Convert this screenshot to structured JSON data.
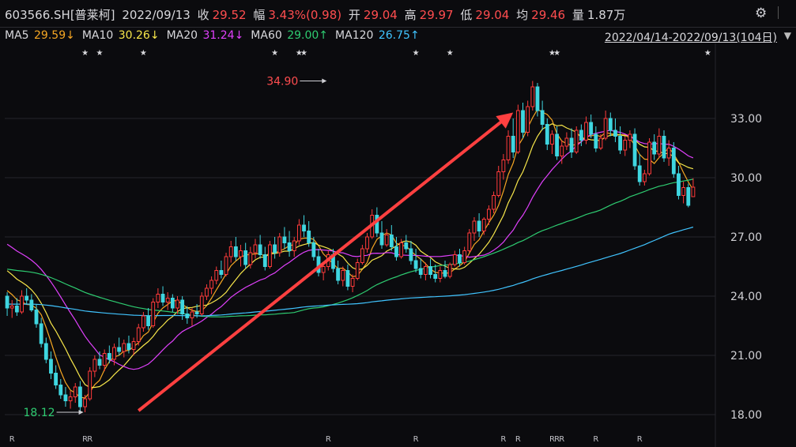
{
  "header": {
    "code": "603566.SH[普莱柯]",
    "date": "2022/09/13",
    "close_label": "收",
    "close": "29.52",
    "change_label": "幅",
    "change": "3.43%(0.98)",
    "open_label": "开",
    "open": "29.04",
    "high_label": "高",
    "high": "29.97",
    "low_label": "低",
    "low": "29.04",
    "avg_label": "均",
    "avg": "29.46",
    "vol_label": "量",
    "vol": "1.87万",
    "settings_icon": "gear-icon"
  },
  "ma_legend": [
    {
      "label": "MA5",
      "value": "29.59↓",
      "color": "#f5a623"
    },
    {
      "label": "MA10",
      "value": "30.26↓",
      "color": "#f7e64a"
    },
    {
      "label": "MA20",
      "value": "31.24↓",
      "color": "#e040fb"
    },
    {
      "label": "MA60",
      "value": "29.00↑",
      "color": "#2ecc71"
    },
    {
      "label": "MA120",
      "value": "26.75↑",
      "color": "#40c4ff"
    }
  ],
  "range_label": "2022/04/14-2022/09/13(104日)",
  "chart_data": {
    "type": "candlestick",
    "ylim": [
      17.2,
      36.2
    ],
    "yticks": [
      "33.00",
      "30.00",
      "27.00",
      "24.00",
      "21.00",
      "18.00"
    ],
    "ytick_values": [
      33,
      30,
      27,
      24,
      21,
      18
    ],
    "colors": {
      "up": "#ff3b3b",
      "down": "#3fd6e0",
      "arrow": "#ff4040"
    },
    "annotations": [
      {
        "text": "34.90",
        "value": 34.9,
        "index": 66,
        "color": "#ff4d4f"
      },
      {
        "text": "18.12",
        "value": 18.12,
        "index": 16,
        "color": "#2ecc71"
      }
    ],
    "star_indices": [
      16,
      19,
      28,
      55,
      60,
      61,
      84,
      91,
      112,
      113,
      144
    ],
    "star_marks": [
      "★",
      "★",
      "★",
      "★",
      "★",
      "★",
      "★",
      "★",
      "★",
      "★",
      "★"
    ],
    "r_indices": [
      1,
      16,
      17,
      66,
      84,
      102,
      105,
      112,
      113,
      114,
      121,
      130
    ],
    "r_marks": [
      "R",
      "R",
      "R",
      "R",
      "R",
      "R",
      "R",
      "R",
      "R",
      "R",
      "R",
      "R"
    ],
    "trend_arrow": {
      "from": [
        27,
        18.2
      ],
      "to": [
        104,
        33.3
      ]
    },
    "candles": [
      [
        24.0,
        24.2,
        23.0,
        23.4
      ],
      [
        23.4,
        23.8,
        22.9,
        23.5
      ],
      [
        23.5,
        23.9,
        23.0,
        23.2
      ],
      [
        23.2,
        24.3,
        23.1,
        24.0
      ],
      [
        24.0,
        24.4,
        23.6,
        23.8
      ],
      [
        23.8,
        24.1,
        23.2,
        23.3
      ],
      [
        23.3,
        23.6,
        22.4,
        22.6
      ],
      [
        22.6,
        22.9,
        21.4,
        21.6
      ],
      [
        21.6,
        21.9,
        20.6,
        20.8
      ],
      [
        20.8,
        21.2,
        19.8,
        20.1
      ],
      [
        20.1,
        20.5,
        19.3,
        19.5
      ],
      [
        19.5,
        19.8,
        18.8,
        19.0
      ],
      [
        19.0,
        19.4,
        18.4,
        18.7
      ],
      [
        18.7,
        19.2,
        18.3,
        18.9
      ],
      [
        18.9,
        19.6,
        18.6,
        19.4
      ],
      [
        19.4,
        19.7,
        18.2,
        18.4
      ],
      [
        18.4,
        19.0,
        18.12,
        18.8
      ],
      [
        18.8,
        20.4,
        18.7,
        20.2
      ],
      [
        20.2,
        21.0,
        19.9,
        20.8
      ],
      [
        20.8,
        21.2,
        20.3,
        20.5
      ],
      [
        20.5,
        21.3,
        20.2,
        21.1
      ],
      [
        21.1,
        21.5,
        20.6,
        20.8
      ],
      [
        20.8,
        21.6,
        20.5,
        21.4
      ],
      [
        21.4,
        21.9,
        21.0,
        21.2
      ],
      [
        21.2,
        21.8,
        20.9,
        21.6
      ],
      [
        21.6,
        22.0,
        21.1,
        21.3
      ],
      [
        21.3,
        21.9,
        21.0,
        21.7
      ],
      [
        21.7,
        22.6,
        21.5,
        22.4
      ],
      [
        22.4,
        23.2,
        22.2,
        23.0
      ],
      [
        23.0,
        23.4,
        22.3,
        22.5
      ],
      [
        22.5,
        23.9,
        22.4,
        23.7
      ],
      [
        23.7,
        24.4,
        23.4,
        24.1
      ],
      [
        24.1,
        24.5,
        23.5,
        23.7
      ],
      [
        23.7,
        24.2,
        23.3,
        23.9
      ],
      [
        23.9,
        24.1,
        23.2,
        23.4
      ],
      [
        23.4,
        24.0,
        23.1,
        23.8
      ],
      [
        23.8,
        24.0,
        22.8,
        23.1
      ],
      [
        23.1,
        23.5,
        22.6,
        22.9
      ],
      [
        22.9,
        23.4,
        22.5,
        23.2
      ],
      [
        23.2,
        23.6,
        22.9,
        23.1
      ],
      [
        23.1,
        24.2,
        23.0,
        24.0
      ],
      [
        24.0,
        24.6,
        23.8,
        24.4
      ],
      [
        24.4,
        25.0,
        24.1,
        24.8
      ],
      [
        24.8,
        25.5,
        24.6,
        25.3
      ],
      [
        25.3,
        25.8,
        24.9,
        25.1
      ],
      [
        25.1,
        26.2,
        25.0,
        26.0
      ],
      [
        26.0,
        26.8,
        25.7,
        26.5
      ],
      [
        26.5,
        27.0,
        25.8,
        26.0
      ],
      [
        26.0,
        26.6,
        25.5,
        26.3
      ],
      [
        26.3,
        26.7,
        25.4,
        25.6
      ],
      [
        25.6,
        26.5,
        25.4,
        26.2
      ],
      [
        26.2,
        26.9,
        25.9,
        26.6
      ],
      [
        26.6,
        27.1,
        25.9,
        26.1
      ],
      [
        26.1,
        26.5,
        25.3,
        25.5
      ],
      [
        25.5,
        26.8,
        25.4,
        26.6
      ],
      [
        26.6,
        27.0,
        25.9,
        26.2
      ],
      [
        26.2,
        27.2,
        26.0,
        27.0
      ],
      [
        27.0,
        27.5,
        26.4,
        26.7
      ],
      [
        26.7,
        27.3,
        26.0,
        26.3
      ],
      [
        26.3,
        27.0,
        26.0,
        26.8
      ],
      [
        26.8,
        27.9,
        26.6,
        27.6
      ],
      [
        27.6,
        28.1,
        27.0,
        27.3
      ],
      [
        27.3,
        27.8,
        26.5,
        26.7
      ],
      [
        26.7,
        27.0,
        25.8,
        26.0
      ],
      [
        26.0,
        26.4,
        25.0,
        25.2
      ],
      [
        25.2,
        25.7,
        24.8,
        25.5
      ],
      [
        25.5,
        26.3,
        25.3,
        26.1
      ],
      [
        26.1,
        26.4,
        25.2,
        25.4
      ],
      [
        25.4,
        25.8,
        24.6,
        24.8
      ],
      [
        24.8,
        25.5,
        24.5,
        25.3
      ],
      [
        25.3,
        25.6,
        24.3,
        24.5
      ],
      [
        24.5,
        25.1,
        24.2,
        24.9
      ],
      [
        24.9,
        25.9,
        24.8,
        25.7
      ],
      [
        25.7,
        26.6,
        25.6,
        26.4
      ],
      [
        26.4,
        27.2,
        26.2,
        27.0
      ],
      [
        27.0,
        28.4,
        26.9,
        28.1
      ],
      [
        28.1,
        28.5,
        27.0,
        27.2
      ],
      [
        27.2,
        27.8,
        26.4,
        26.6
      ],
      [
        26.6,
        27.4,
        26.5,
        27.1
      ],
      [
        27.1,
        27.6,
        26.3,
        26.5
      ],
      [
        26.5,
        27.0,
        25.8,
        26.0
      ],
      [
        26.0,
        26.9,
        25.9,
        26.7
      ],
      [
        26.7,
        27.1,
        26.2,
        26.4
      ],
      [
        26.4,
        26.8,
        25.6,
        25.8
      ],
      [
        25.8,
        26.4,
        25.2,
        25.4
      ],
      [
        25.4,
        25.9,
        24.9,
        25.1
      ],
      [
        25.1,
        25.7,
        24.8,
        25.5
      ],
      [
        25.5,
        25.9,
        24.9,
        25.1
      ],
      [
        25.1,
        25.6,
        24.7,
        24.9
      ],
      [
        24.9,
        25.5,
        24.7,
        25.3
      ],
      [
        25.3,
        25.8,
        24.9,
        25.0
      ],
      [
        25.0,
        25.7,
        24.9,
        25.6
      ],
      [
        25.6,
        26.3,
        25.5,
        26.1
      ],
      [
        26.1,
        26.4,
        25.5,
        25.7
      ],
      [
        25.7,
        26.5,
        25.6,
        26.3
      ],
      [
        26.3,
        27.4,
        26.2,
        27.2
      ],
      [
        27.2,
        28.0,
        26.8,
        27.8
      ],
      [
        27.8,
        28.2,
        27.0,
        27.3
      ],
      [
        27.3,
        28.0,
        27.1,
        27.9
      ],
      [
        27.9,
        28.6,
        27.6,
        28.4
      ],
      [
        28.4,
        29.3,
        28.2,
        29.1
      ],
      [
        29.1,
        30.6,
        29.0,
        30.3
      ],
      [
        30.3,
        31.2,
        29.9,
        30.9
      ],
      [
        30.9,
        32.4,
        30.7,
        32.1
      ],
      [
        32.1,
        33.0,
        31.0,
        31.3
      ],
      [
        31.3,
        33.7,
        31.2,
        33.4
      ],
      [
        33.4,
        33.8,
        32.0,
        32.3
      ],
      [
        32.3,
        33.9,
        32.1,
        33.6
      ],
      [
        33.6,
        34.9,
        33.4,
        34.6
      ],
      [
        34.6,
        34.8,
        33.1,
        33.4
      ],
      [
        33.4,
        33.9,
        32.4,
        32.7
      ],
      [
        32.7,
        33.0,
        31.4,
        31.7
      ],
      [
        31.7,
        32.4,
        31.2,
        32.2
      ],
      [
        32.2,
        32.6,
        30.9,
        31.1
      ],
      [
        31.1,
        31.9,
        30.7,
        31.6
      ],
      [
        31.6,
        32.3,
        31.4,
        32.0
      ],
      [
        32.0,
        32.5,
        31.0,
        31.3
      ],
      [
        31.3,
        32.6,
        31.2,
        32.4
      ],
      [
        32.4,
        32.7,
        31.6,
        31.9
      ],
      [
        31.9,
        33.1,
        31.7,
        32.8
      ],
      [
        32.8,
        33.2,
        32.0,
        32.2
      ],
      [
        32.2,
        32.6,
        31.3,
        31.5
      ],
      [
        31.5,
        32.2,
        31.4,
        32.0
      ],
      [
        32.0,
        33.4,
        31.9,
        33.0
      ],
      [
        33.0,
        33.3,
        32.1,
        32.4
      ],
      [
        32.4,
        33.0,
        31.8,
        32.1
      ],
      [
        32.1,
        32.6,
        31.2,
        31.4
      ],
      [
        31.4,
        32.1,
        31.1,
        31.9
      ],
      [
        31.9,
        32.4,
        31.5,
        32.2
      ],
      [
        32.2,
        32.5,
        30.4,
        30.6
      ],
      [
        30.6,
        31.2,
        29.6,
        29.8
      ],
      [
        29.8,
        30.4,
        29.6,
        30.2
      ],
      [
        30.2,
        32.0,
        30.1,
        31.8
      ],
      [
        31.8,
        32.2,
        30.9,
        31.2
      ],
      [
        31.2,
        32.5,
        31.0,
        32.1
      ],
      [
        32.1,
        32.4,
        30.8,
        31.0
      ],
      [
        31.0,
        31.9,
        30.6,
        31.5
      ],
      [
        31.5,
        31.8,
        30.0,
        30.2
      ],
      [
        30.2,
        30.6,
        28.9,
        29.1
      ],
      [
        29.1,
        29.8,
        28.7,
        29.5
      ],
      [
        29.5,
        29.7,
        28.5,
        28.6
      ],
      [
        29.04,
        29.97,
        29.04,
        29.52
      ]
    ]
  }
}
